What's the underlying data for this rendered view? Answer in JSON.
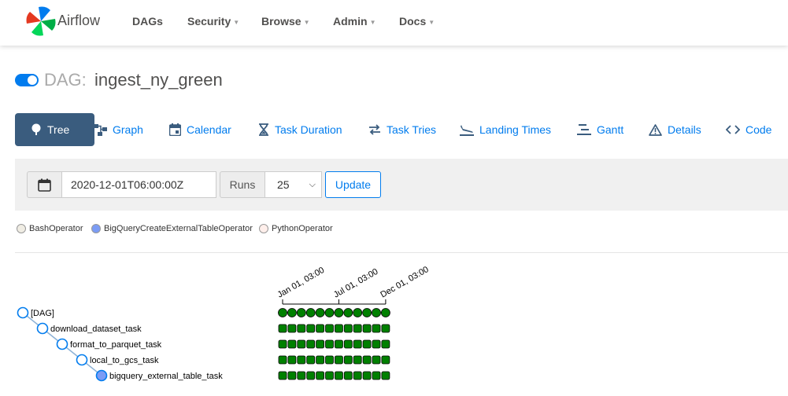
{
  "navbar": {
    "brand": "Airflow",
    "items": [
      {
        "label": "DAGs",
        "dropdown": false
      },
      {
        "label": "Security",
        "dropdown": true
      },
      {
        "label": "Browse",
        "dropdown": true
      },
      {
        "label": "Admin",
        "dropdown": true
      },
      {
        "label": "Docs",
        "dropdown": true
      }
    ]
  },
  "dag": {
    "prefix": "DAG:",
    "name": "ingest_ny_green",
    "enabled": true
  },
  "tabs": [
    {
      "label": "Tree",
      "icon": "tree-icon",
      "active": true
    },
    {
      "label": "Graph",
      "icon": "graph-icon",
      "active": false
    },
    {
      "label": "Calendar",
      "icon": "calendar-icon",
      "active": false
    },
    {
      "label": "Task Duration",
      "icon": "hourglass-icon",
      "active": false
    },
    {
      "label": "Task Tries",
      "icon": "retry-icon",
      "active": false
    },
    {
      "label": "Landing Times",
      "icon": "plane-landing-icon",
      "active": false
    },
    {
      "label": "Gantt",
      "icon": "gantt-icon",
      "active": false
    },
    {
      "label": "Details",
      "icon": "warning-triangle-icon",
      "active": false
    },
    {
      "label": "Code",
      "icon": "code-icon",
      "active": false
    }
  ],
  "toolbar": {
    "base_date": "2020-12-01T06:00:00Z",
    "runs_label": "Runs",
    "runs_value": "25",
    "update_label": "Update"
  },
  "legend": [
    {
      "label": "BashOperator",
      "color": "#f0ede4"
    },
    {
      "label": "BigQueryCreateExternalTableOperator",
      "color": "#7b9cf5"
    },
    {
      "label": "PythonOperator",
      "color": "#ffefeb"
    }
  ],
  "tree": {
    "axis_ticks": [
      "Jan 01, 03:00",
      "Jul 01, 03:00",
      "Dec 01, 03:00"
    ],
    "run_count": 12,
    "run_state_color": "#008000",
    "nodes": [
      {
        "label": "[DAG]",
        "depth": 0,
        "fill": "#ffffff"
      },
      {
        "label": "download_dataset_task",
        "depth": 1,
        "fill": "#ffffff"
      },
      {
        "label": "format_to_parquet_task",
        "depth": 2,
        "fill": "#ffffff"
      },
      {
        "label": "local_to_gcs_task",
        "depth": 3,
        "fill": "#ffffff"
      },
      {
        "label": "bigquery_external_table_task",
        "depth": 4,
        "fill": "#7b9cf5"
      }
    ]
  }
}
